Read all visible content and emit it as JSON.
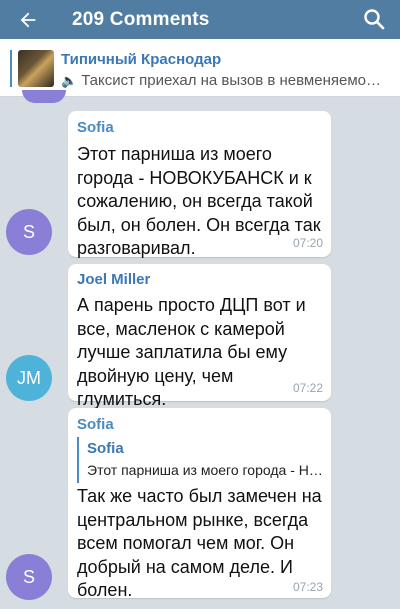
{
  "header": {
    "title": "209 Comments",
    "back_icon": "arrow-left-icon",
    "search_icon": "search-icon",
    "background_color": "#517da2"
  },
  "pinned": {
    "title": "Типичный Краснодар",
    "text": "Таксист приехал на вызов в невменяемом состоянии",
    "audio_icon": "speaker-icon"
  },
  "messages": [
    {
      "author": "Sofia",
      "author_color": "#4a8bc2",
      "avatar_letter": "S",
      "avatar_color": "#8a7fd6",
      "text": "Этот парниша из моего города - НОВОКУБАНСК и к сожалению, он всегда такой был, он болен. Он всегда так разговаривал.",
      "time": "07:20"
    },
    {
      "author": "Joel Miller",
      "author_color": "#3a78b6",
      "avatar_letter": "JM",
      "avatar_color": "#4fb3d9",
      "text": "А парень просто ДЦП вот и все, масленок с камерой лучше заплатила бы ему двойную цену, чем глумиться.",
      "time": "07:22"
    },
    {
      "author": "Sofia",
      "author_color": "#4a8bc2",
      "avatar_letter": "S",
      "avatar_color": "#8a7fd6",
      "reply_to": {
        "author": "Sofia",
        "text": "Этот парниша из моего города - НОВОКУБАНСК и к сожалению"
      },
      "text": "Так же часто был замечен на центральном рынке, всегда всем помогал чем мог. Он добрый на самом деле. И болен.",
      "time": "07:23"
    }
  ]
}
